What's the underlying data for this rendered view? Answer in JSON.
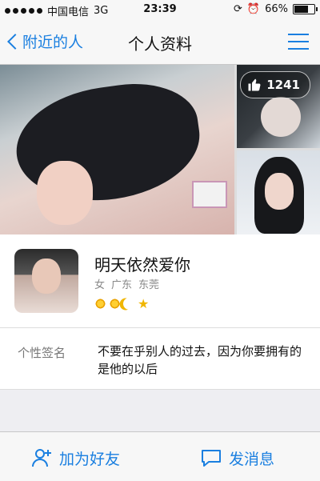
{
  "status_bar": {
    "carrier": "中国电信",
    "network": "3G",
    "time": "23:39",
    "battery": "66%",
    "battery_level": 0.66
  },
  "nav": {
    "back_label": "附近的人",
    "title": "个人资料"
  },
  "photos": {
    "like_count": "1241"
  },
  "profile": {
    "nickname": "明天依然爱你",
    "gender": "女",
    "province": "广东",
    "city": "东莞",
    "level_icons": [
      "sun-icon",
      "sun-icon",
      "moon-icon",
      "star-icon"
    ]
  },
  "signature": {
    "label": "个性签名",
    "text": "不要在乎别人的过去，因为你要拥有的是他的以后"
  },
  "actions": {
    "add_friend": "加为好友",
    "send_message": "发消息"
  },
  "colors": {
    "accent": "#1a7fe0",
    "level_gold": "#f0b600"
  }
}
